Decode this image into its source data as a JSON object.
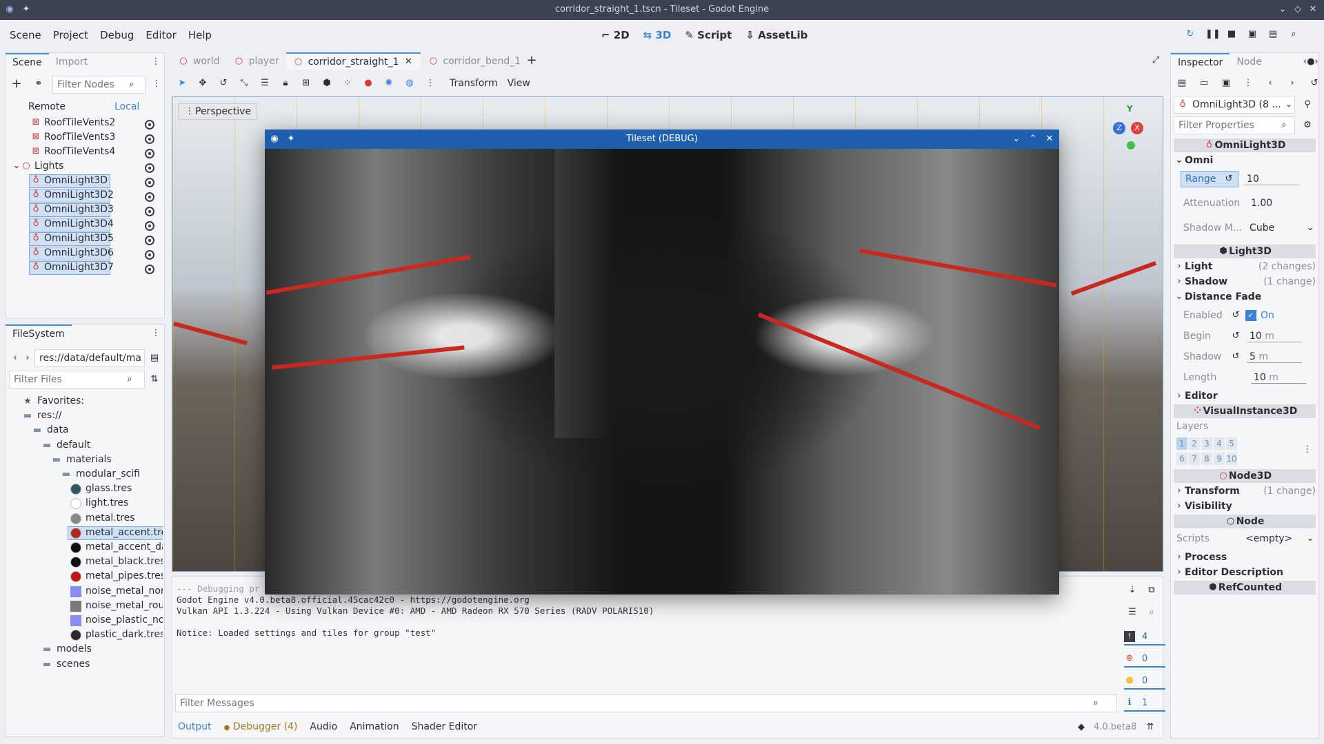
{
  "window": {
    "title": "corridor_straight_1.tscn - Tileset - Godot Engine"
  },
  "menu": [
    "Scene",
    "Project",
    "Debug",
    "Editor",
    "Help"
  ],
  "workspaces": [
    {
      "label": "2D",
      "active": false
    },
    {
      "label": "3D",
      "active": true
    },
    {
      "label": "Script",
      "active": false
    },
    {
      "label": "AssetLib",
      "active": false
    }
  ],
  "scene_dock": {
    "tabs": [
      "Scene",
      "Import"
    ],
    "filter_placeholder": "Filter Nodes",
    "remote": "Remote",
    "local": "Local",
    "nodes": [
      {
        "label": "RoofTileVents2",
        "indent": 1,
        "icon": "grid-icon"
      },
      {
        "label": "RoofTileVents3",
        "indent": 1,
        "icon": "grid-icon"
      },
      {
        "label": "RoofTileVents4",
        "indent": 1,
        "icon": "grid-icon"
      },
      {
        "label": "Lights",
        "indent": 0,
        "icon": "node-icon"
      },
      {
        "label": "OmniLight3D",
        "indent": 1,
        "icon": "light-icon"
      },
      {
        "label": "OmniLight3D2",
        "indent": 1,
        "icon": "light-icon"
      },
      {
        "label": "OmniLight3D3",
        "indent": 1,
        "icon": "light-icon"
      },
      {
        "label": "OmniLight3D4",
        "indent": 1,
        "icon": "light-icon"
      },
      {
        "label": "OmniLight3D5",
        "indent": 1,
        "icon": "light-icon"
      },
      {
        "label": "OmniLight3D6",
        "indent": 1,
        "icon": "light-icon"
      },
      {
        "label": "OmniLight3D7",
        "indent": 1,
        "icon": "light-icon"
      }
    ]
  },
  "filesystem": {
    "tab": "FileSystem",
    "path": "res://data/default/ma",
    "filter_placeholder": "Filter Files",
    "items": [
      {
        "label": "Favorites:",
        "indent": 0,
        "kind": "star"
      },
      {
        "label": "res://",
        "indent": 0,
        "kind": "folder"
      },
      {
        "label": "data",
        "indent": 1,
        "kind": "folder"
      },
      {
        "label": "default",
        "indent": 2,
        "kind": "folder"
      },
      {
        "label": "materials",
        "indent": 3,
        "kind": "folder"
      },
      {
        "label": "modular_scifi",
        "indent": 4,
        "kind": "folder"
      },
      {
        "label": "glass.tres",
        "indent": 5,
        "kind": "res",
        "color": "#2f5563"
      },
      {
        "label": "light.tres",
        "indent": 5,
        "kind": "res",
        "color": "#ffffff"
      },
      {
        "label": "metal.tres",
        "indent": 5,
        "kind": "res",
        "color": "#888888"
      },
      {
        "label": "metal_accent.tres",
        "indent": 5,
        "kind": "res",
        "color": "#b0281f"
      },
      {
        "label": "metal_accent_dark.",
        "indent": 5,
        "kind": "res",
        "color": "#111111"
      },
      {
        "label": "metal_black.tres",
        "indent": 5,
        "kind": "res",
        "color": "#111111"
      },
      {
        "label": "metal_pipes.tres",
        "indent": 5,
        "kind": "res",
        "color": "#c01515"
      },
      {
        "label": "noise_metal_norm.",
        "indent": 5,
        "kind": "tex",
        "color": "#8a8cf0"
      },
      {
        "label": "noise_metal_rough",
        "indent": 5,
        "kind": "tex",
        "color": "#7a7a7a"
      },
      {
        "label": "noise_plastic_norm",
        "indent": 5,
        "kind": "tex",
        "color": "#8a8cf0"
      },
      {
        "label": "plastic_dark.tres",
        "indent": 5,
        "kind": "res",
        "color": "#2a2a2a"
      },
      {
        "label": "models",
        "indent": 2,
        "kind": "folder"
      },
      {
        "label": "scenes",
        "indent": 2,
        "kind": "folder"
      }
    ]
  },
  "scene_tabs": [
    "world",
    "player",
    "corridor_straight_1",
    "corridor_bend_1"
  ],
  "viewport": {
    "menus": [
      "Transform",
      "View"
    ],
    "perspective": "Perspective",
    "gizmo": {
      "x": "X",
      "y": "Y",
      "z": "Z"
    }
  },
  "debug_window": {
    "title": "Tileset (DEBUG)"
  },
  "console": {
    "lines": [
      "--- Debugging pr",
      "Godot Engine v4.0.beta8.official.45cac42c0 - https://godotengine.org",
      "Vulkan API 1.3.224 - Using Vulkan Device #0: AMD - AMD Radeon RX 570 Series (RADV POLARIS10)",
      "",
      "Notice: Loaded settings and tiles for group \"test\""
    ],
    "filter_placeholder": "Filter Messages",
    "counts": {
      "errors": "4",
      "warnings": "0",
      "notices": "0",
      "info": "1"
    },
    "bottom_tabs": [
      "Output",
      "Debugger (4)",
      "Audio",
      "Animation",
      "Shader Editor"
    ],
    "version": "4.0.beta8"
  },
  "inspector": {
    "tabs": [
      "Inspector",
      "Node"
    ],
    "object": "OmniLight3D (8 ...",
    "filter_placeholder": "Filter Properties",
    "sections": {
      "omnilight": "OmniLight3D",
      "omni": "Omni",
      "range_label": "Range",
      "range_value": "10",
      "atten_label": "Attenuation",
      "atten_value": "1.00",
      "shadow_mode_label": "Shadow M...",
      "shadow_mode_value": "Cube",
      "light3d": "Light3D",
      "light": "Light",
      "light_changes": "(2 changes)",
      "shadow": "Shadow",
      "shadow_changes": "(1 change)",
      "distance_fade": "Distance Fade",
      "enabled_label": "Enabled",
      "enabled_value": "On",
      "begin_label": "Begin",
      "begin_value": "10",
      "begin_unit": "m",
      "shadow_label": "Shadow",
      "shadow_value": "5",
      "shadow_unit": "m",
      "length_label": "Length",
      "length_value": "10",
      "length_unit": "m",
      "editor": "Editor",
      "visualinstance": "VisualInstance3D",
      "layers": "Layers",
      "layer_row1": [
        "1",
        "2",
        "3",
        "4",
        "5"
      ],
      "layer_row2": [
        "6",
        "7",
        "8",
        "9",
        "10"
      ],
      "node3d": "Node3D",
      "transform": "Transform",
      "transform_changes": "(1 change)",
      "visibility": "Visibility",
      "node": "Node",
      "scripts_label": "Scripts",
      "scripts_value": "<empty>",
      "process": "Process",
      "editor_description": "Editor Description",
      "refcounted": "RefCounted"
    }
  },
  "colors": {
    "accent": "#3b82d6",
    "error": "#e0483a",
    "light_icon": "#d23b3b"
  }
}
